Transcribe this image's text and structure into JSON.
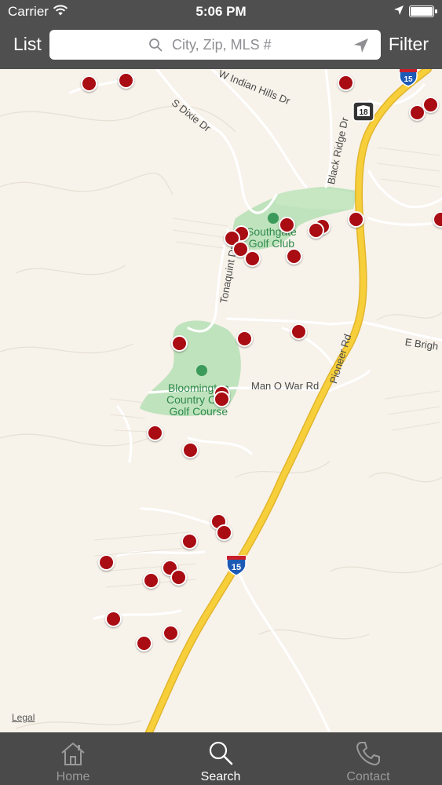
{
  "status_bar": {
    "carrier": "Carrier",
    "time": "5:06 PM"
  },
  "nav": {
    "left_button": "List",
    "right_button": "Filter",
    "search_placeholder": "City, Zip, MLS #"
  },
  "map": {
    "labels": {
      "s_dixie": "S Dixie Dr",
      "indian_hills": "W Indian Hills Dr",
      "black_ridge": "Black Ridge Dr",
      "tonaquint": "Tonaquint Dr",
      "pioneer": "Pioneer Rd",
      "e_brigham": "E Brigh",
      "man_o_war": "Man O War Rd",
      "southgate": "Southgate\nGolf Club",
      "bloomington": "Bloomington\nCountry Club\nGolf Course",
      "shield_15a": "15",
      "shield_15b": "15",
      "shield_18": "18"
    },
    "legal": "Legal",
    "accent_color": "#a90c12",
    "highway_color": "#f6cf3b",
    "listing_count_visible": 43
  },
  "tabs": [
    {
      "label": "Home",
      "icon": "home-icon",
      "active": false
    },
    {
      "label": "Search",
      "icon": "search-icon",
      "active": true
    },
    {
      "label": "Contact",
      "icon": "phone-icon",
      "active": false
    }
  ]
}
